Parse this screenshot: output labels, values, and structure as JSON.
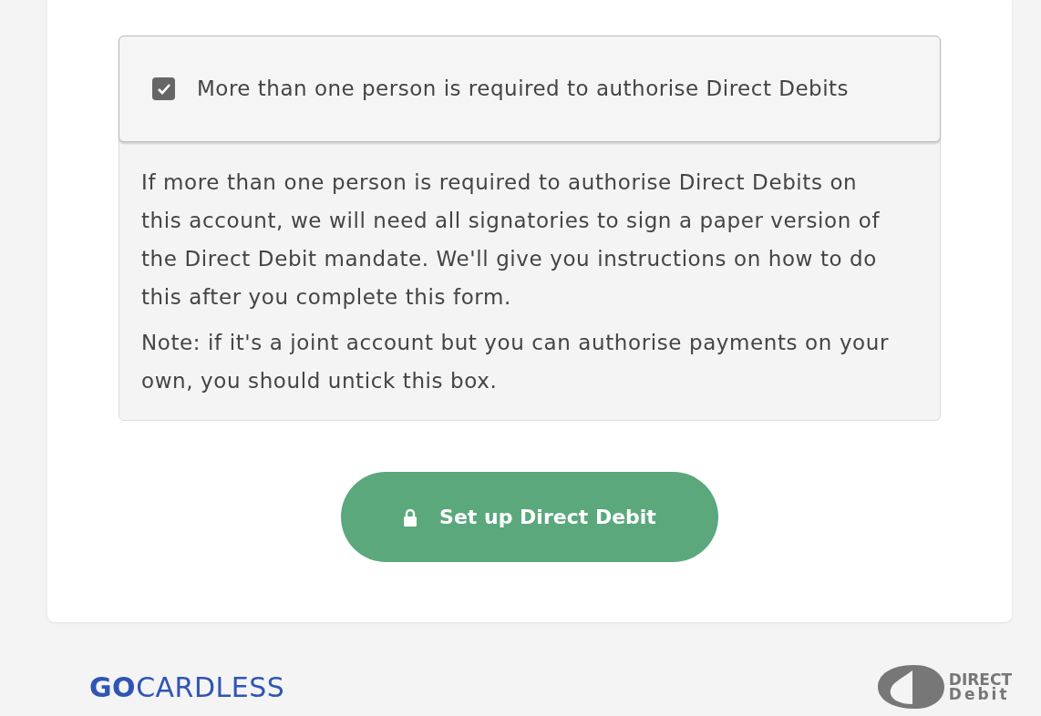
{
  "consent": {
    "label": "More than one person is required to authorise Direct Debits",
    "checked": true
  },
  "details": [
    "If more than one person is required to authorise Direct Debits on this account, we will need all signatories to sign a paper version of the Direct Debit mandate. We'll give you instructions on how to do this after you complete this form.",
    "Note: if it's a joint account but you can authorise payments on your own, you should untick this box."
  ],
  "submit_button": {
    "label": "Set up Direct Debit"
  },
  "footer": {
    "brand": "**GO**CARDLESS",
    "scheme_logo": [
      "DIRECT",
      "Debit"
    ]
  }
}
